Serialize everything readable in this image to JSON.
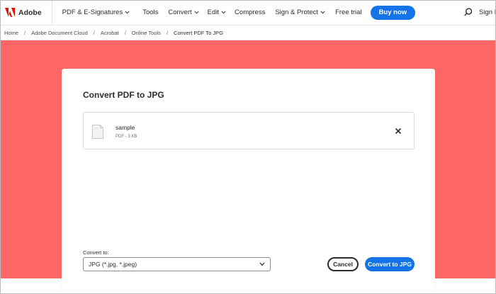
{
  "brand": {
    "name": "Adobe",
    "color": "#eb1000"
  },
  "nav": {
    "items": [
      {
        "label": "PDF & E-Signatures",
        "dropdown": true
      },
      {
        "label": "Tools",
        "dropdown": false
      },
      {
        "label": "Convert",
        "dropdown": true
      },
      {
        "label": "Edit",
        "dropdown": true
      },
      {
        "label": "Compress",
        "dropdown": false
      },
      {
        "label": "Sign & Protect",
        "dropdown": true
      },
      {
        "label": "Free trial",
        "dropdown": false
      }
    ],
    "buy_now": "Buy now",
    "sign_in": "Sign In"
  },
  "breadcrumb": [
    "Home",
    "Adobe Document Cloud",
    "Acrobat",
    "Online Tools",
    "Convert PDF To JPG"
  ],
  "hero_color": "#fe6666",
  "accent_color": "#1473e6",
  "card": {
    "title": "Convert PDF to JPG",
    "file": {
      "name": "sample",
      "meta": "PDF - 3 KB"
    },
    "convert_to_label": "Convert to:",
    "format_selected": "JPG (*.jpg, *.jpeg)",
    "cancel": "Cancel",
    "convert": "Convert to JPG"
  }
}
